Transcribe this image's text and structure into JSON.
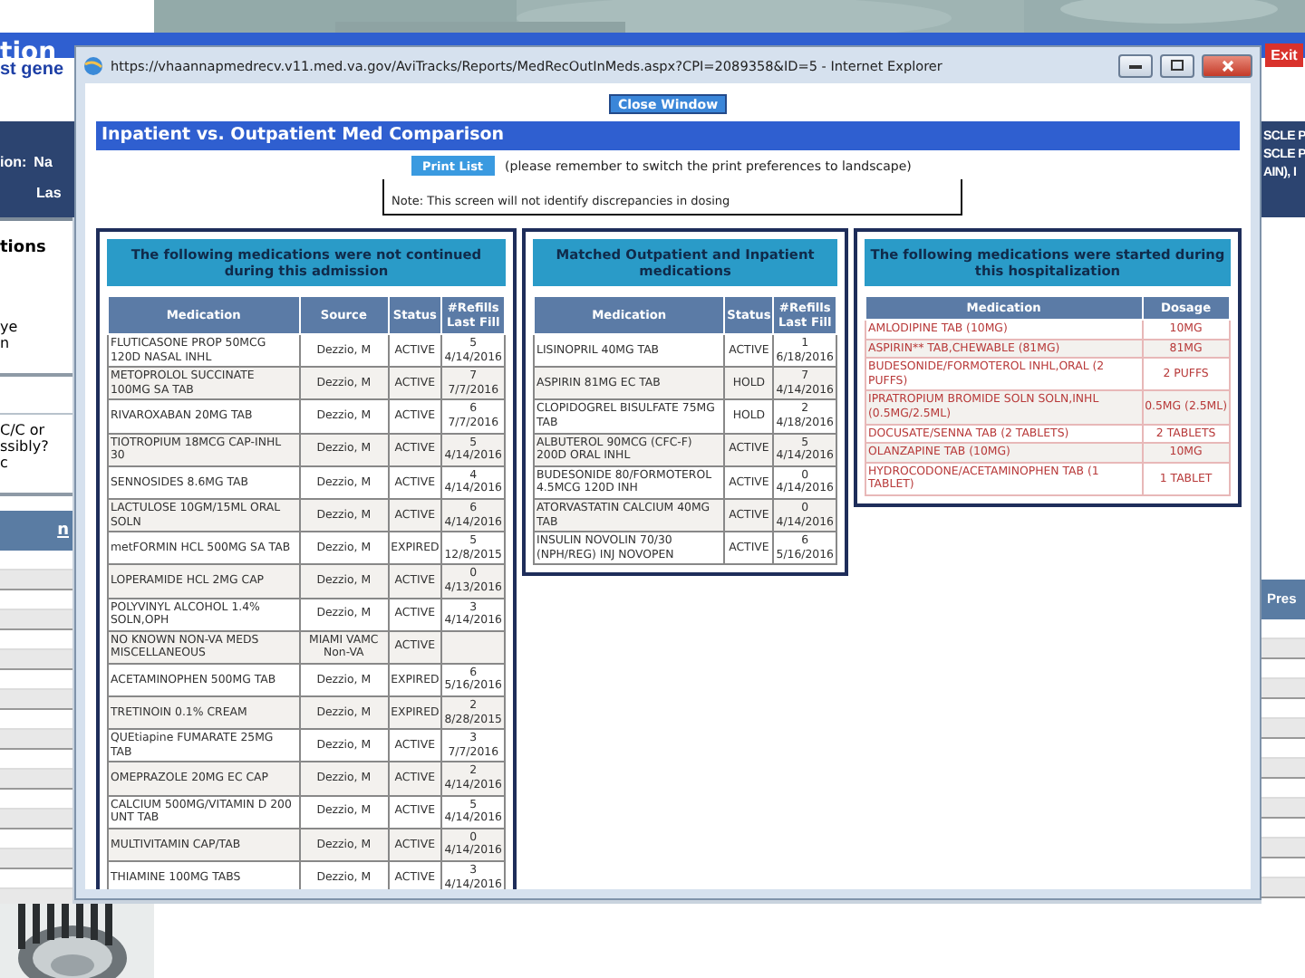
{
  "background_page": {
    "title": "tion",
    "subtitle": "st gene",
    "exit_button": "Exit",
    "patient_labels": {
      "line_1": [
        "ion:",
        "Na"
      ],
      "line_2": [
        "Las"
      ]
    },
    "right_texts": [
      "SCLE P",
      "SCLE P",
      "AIN), I"
    ],
    "left_panel": {
      "heading": "tions",
      "note_groups": [
        [
          "ye",
          "n"
        ],
        [
          "C/C or",
          "ssibly?",
          "c"
        ]
      ],
      "table_header": "n"
    },
    "right_table_header": "Pres"
  },
  "popup": {
    "title": "https://vhaannapmedrecv.v11.med.va.gov/AviTracks/Reports/MedRecOutInMeds.aspx?CPI=2089358&ID=5 - Internet Explorer",
    "close_button": "Close Window",
    "heading": "Inpatient vs. Outpatient Med Comparison",
    "print_button": "Print List",
    "print_hint": "(please remember to switch the print preferences to landscape)",
    "note": "Note: This screen will not identify discrepancies in dosing",
    "panels": [
      {
        "kind": "refills",
        "title": "The following medications were not continued during this admission",
        "columns": [
          "Medication",
          "Source",
          "Status",
          "#Refills",
          "Last Fill"
        ],
        "rows": [
          [
            "FLUTICASONE PROP 50MCG 120D NASAL INHL",
            "Dezzio, M",
            "ACTIVE",
            "5",
            "4/14/2016"
          ],
          [
            "METOPROLOL SUCCINATE 100MG SA TAB",
            "Dezzio, M",
            "ACTIVE",
            "7",
            "7/7/2016"
          ],
          [
            "RIVAROXABAN 20MG TAB",
            "Dezzio, M",
            "ACTIVE",
            "6",
            "7/7/2016"
          ],
          [
            "TIOTROPIUM 18MCG CAP-INHL 30",
            "Dezzio, M",
            "ACTIVE",
            "5",
            "4/14/2016"
          ],
          [
            "SENNOSIDES 8.6MG TAB",
            "Dezzio, M",
            "ACTIVE",
            "4",
            "4/14/2016"
          ],
          [
            "LACTULOSE 10GM/15ML ORAL SOLN",
            "Dezzio, M",
            "ACTIVE",
            "6",
            "4/14/2016"
          ],
          [
            "metFORMIN HCL 500MG SA TAB",
            "Dezzio, M",
            "EXPIRED",
            "5",
            "12/8/2015"
          ],
          [
            "LOPERAMIDE HCL 2MG CAP",
            "Dezzio, M",
            "ACTIVE",
            "0",
            "4/13/2016"
          ],
          [
            "POLYVINYL ALCOHOL 1.4% SOLN,OPH",
            "Dezzio, M",
            "ACTIVE",
            "3",
            "4/14/2016"
          ],
          [
            "NO KNOWN NON-VA MEDS MISCELLANEOUS",
            "MIAMI VAMC Non-VA",
            "ACTIVE"
          ],
          [
            "ACETAMINOPHEN 500MG TAB",
            "Dezzio, M",
            "EXPIRED",
            "6",
            "5/16/2016"
          ],
          [
            "TRETINOIN 0.1% CREAM",
            "Dezzio, M",
            "EXPIRED",
            "2",
            "8/28/2015"
          ],
          [
            "QUEtiapine FUMARATE 25MG TAB",
            "Dezzio, M",
            "ACTIVE",
            "3",
            "7/7/2016"
          ],
          [
            "OMEPRAZOLE 20MG EC CAP",
            "Dezzio, M",
            "ACTIVE",
            "2",
            "4/14/2016"
          ],
          [
            "CALCIUM 500MG/VITAMIN D 200 UNT TAB",
            "Dezzio, M",
            "ACTIVE",
            "5",
            "4/14/2016"
          ],
          [
            "MULTIVITAMIN CAP/TAB",
            "Dezzio, M",
            "ACTIVE",
            "0",
            "4/14/2016"
          ],
          [
            "THIAMINE 100MG TABS",
            "Dezzio, M",
            "ACTIVE",
            "3",
            "4/14/2016"
          ]
        ]
      },
      {
        "kind": "refills",
        "title": "Matched Outpatient and Inpatient medications",
        "columns": [
          "Medication",
          "Status",
          "#Refills",
          "Last Fill"
        ],
        "rows": [
          [
            "LISINOPRIL 40MG TAB",
            "ACTIVE",
            "1",
            "6/18/2016"
          ],
          [
            "ASPIRIN 81MG EC TAB",
            "HOLD",
            "7",
            "4/14/2016"
          ],
          [
            "CLOPIDOGREL BISULFATE 75MG TAB",
            "HOLD",
            "2",
            "4/18/2016"
          ],
          [
            "ALBUTEROL 90MCG (CFC-F) 200D ORAL INHL",
            "ACTIVE",
            "5",
            "4/14/2016"
          ],
          [
            "BUDESONIDE 80/FORMOTEROL 4.5MCG 120D INH",
            "ACTIVE",
            "0",
            "4/14/2016"
          ],
          [
            "ATORVASTATIN CALCIUM 40MG TAB",
            "ACTIVE",
            "0",
            "4/14/2016"
          ],
          [
            "INSULIN NOVOLIN 70/30 (NPH/REG) INJ NOVOPEN",
            "ACTIVE",
            "6",
            "5/16/2016"
          ]
        ]
      },
      {
        "kind": "dosage",
        "title": "The following medications were started during this hospitalization",
        "columns": [
          "Medication",
          "Dosage"
        ],
        "rows": [
          [
            "AMLODIPINE TAB (10MG)",
            "10MG"
          ],
          [
            "ASPIRIN** TAB,CHEWABLE (81MG)",
            "81MG"
          ],
          [
            "BUDESONIDE/FORMOTEROL INHL,ORAL (2 PUFFS)",
            "2 PUFFS"
          ],
          [
            "IPRATROPIUM BROMIDE SOLN SOLN,INHL (0.5MG/2.5ML)",
            "0.5MG (2.5ML)"
          ],
          [
            "DOCUSATE/SENNA TAB (2 TABLETS)",
            "2 TABLETS"
          ],
          [
            "OLANZAPINE TAB (10MG)",
            "10MG"
          ],
          [
            "HYDROCODONE/ACETAMINOPHEN TAB (1 TABLET)",
            "1 TABLET"
          ]
        ]
      }
    ]
  }
}
